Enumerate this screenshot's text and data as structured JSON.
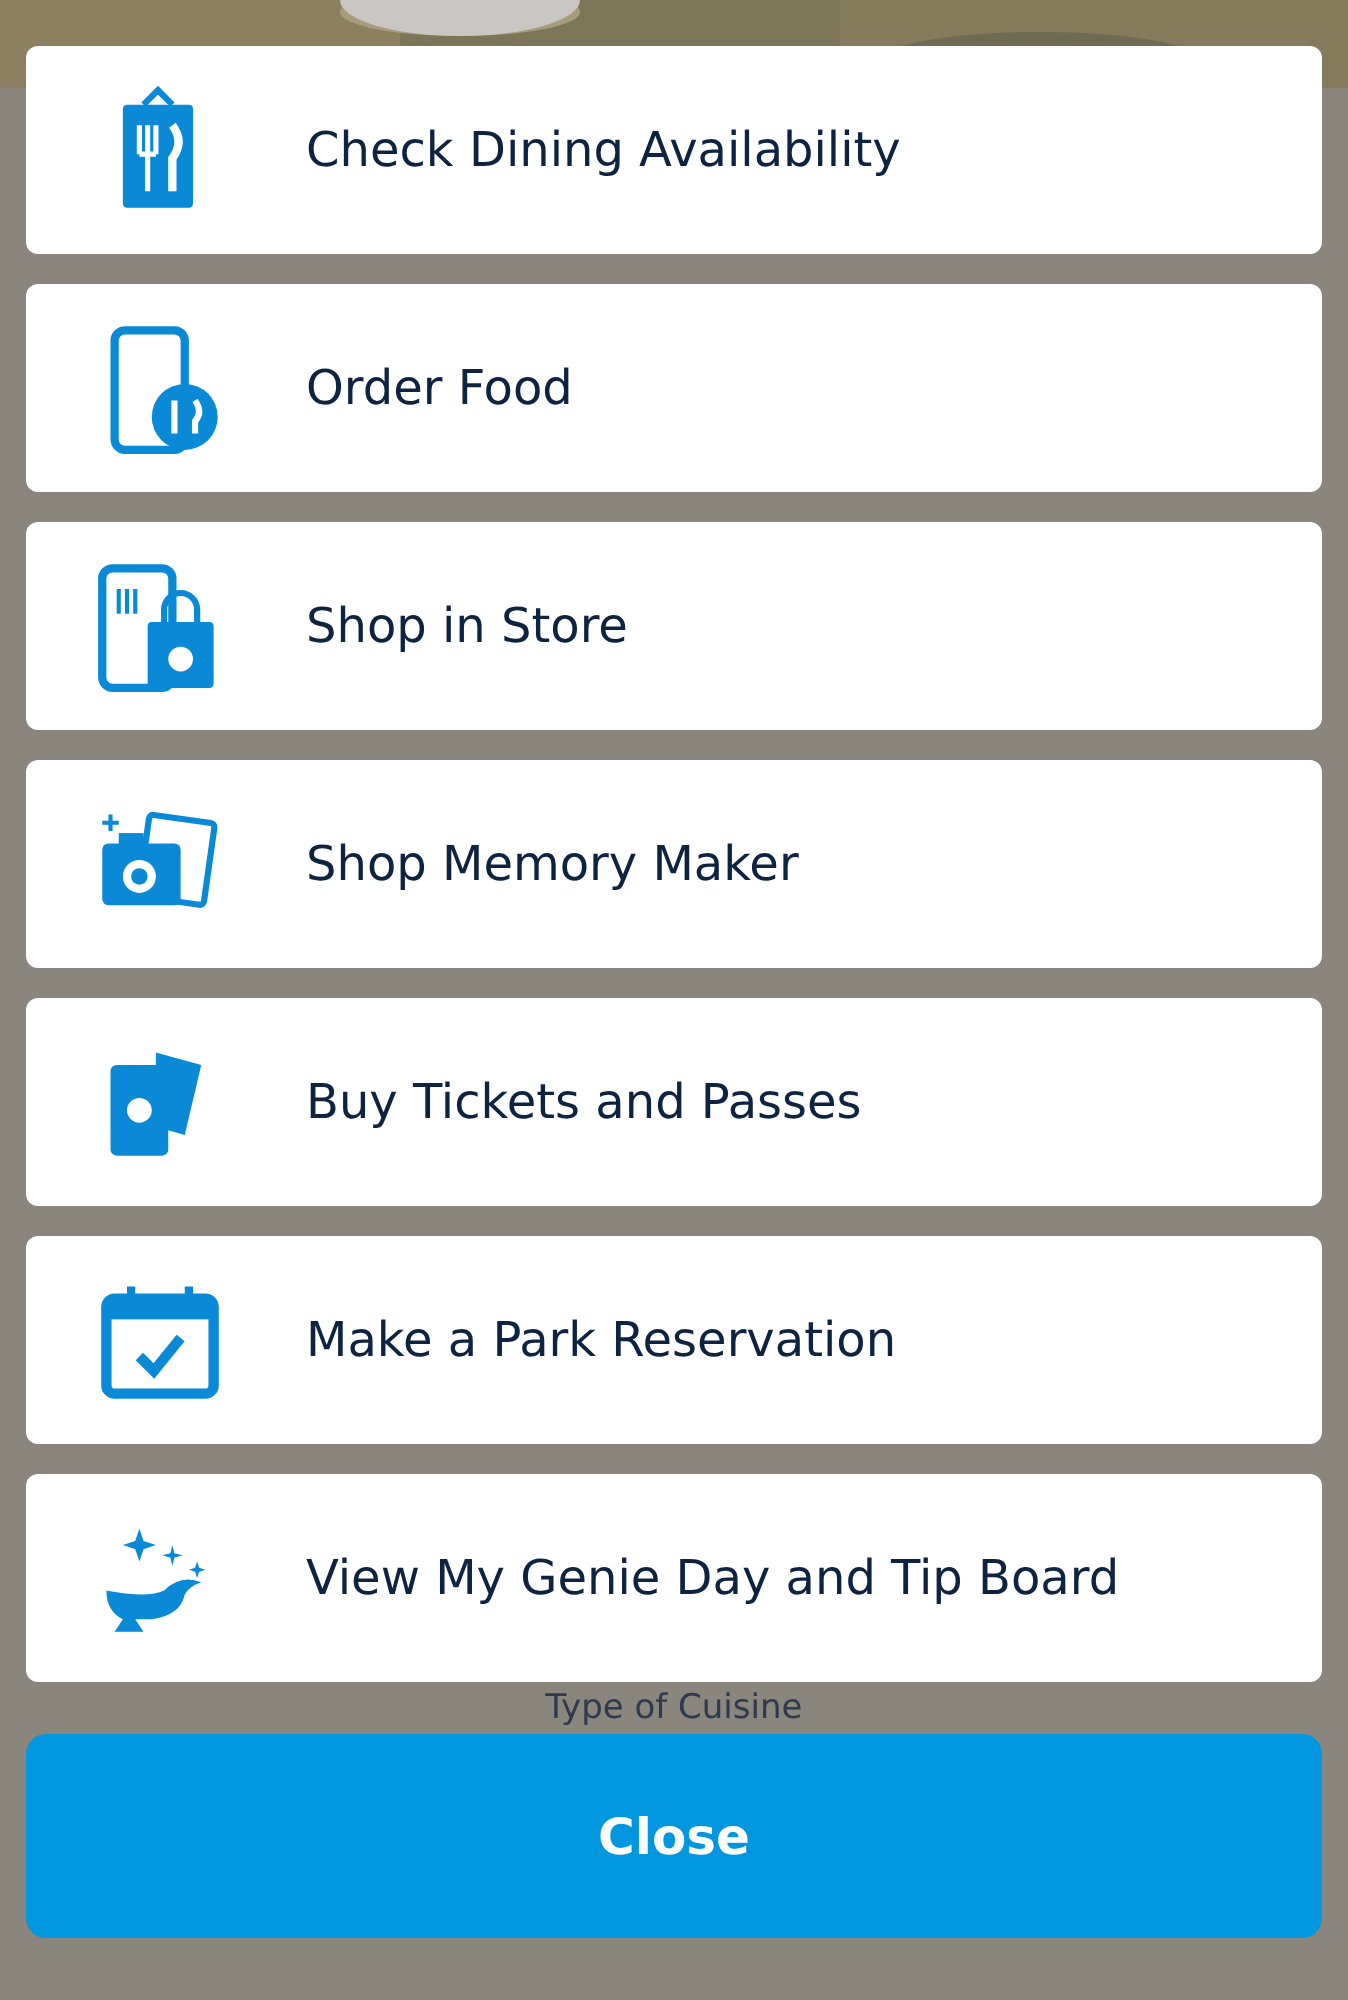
{
  "menu": {
    "items": [
      {
        "label": "Check Dining Availability",
        "kind": "clipboard"
      },
      {
        "label": "Order Food",
        "kind": "phone"
      },
      {
        "label": "Shop in Store",
        "kind": "shop"
      },
      {
        "label": "Shop Memory Maker",
        "kind": "camera"
      },
      {
        "label": "Buy Tickets and Passes",
        "kind": "tickets"
      },
      {
        "label": "Make a Park Reservation",
        "kind": "calendar"
      },
      {
        "label": "View My Genie Day and Tip Board",
        "kind": "lamp"
      }
    ]
  },
  "background_label": "Type of Cuisine",
  "close_button": "Close"
}
